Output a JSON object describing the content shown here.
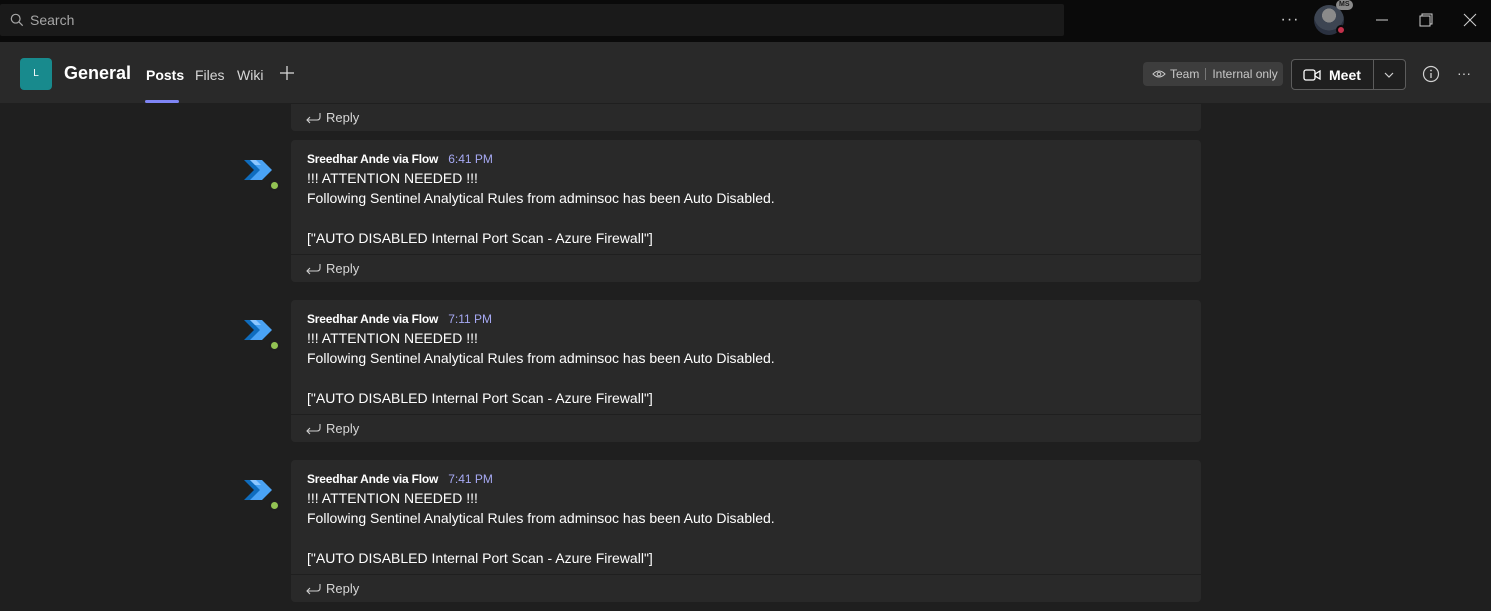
{
  "search": {
    "placeholder": "Search"
  },
  "titlebar": {
    "more_label": "···",
    "avatar_initials": "MS"
  },
  "channel": {
    "team_initial": "L",
    "name": "General",
    "tabs": [
      "Posts",
      "Files",
      "Wiki"
    ],
    "visibility_team": "Team",
    "visibility_scope": "Internal only",
    "meet_label": "Meet"
  },
  "partial_card": {
    "reply_label": "Reply"
  },
  "messages": [
    {
      "author": "Sreedhar Ande via Flow",
      "time": "6:41 PM",
      "line1": "!!! ATTENTION NEEDED !!!",
      "line2": "Following Sentinel Analytical Rules from adminsoc has been Auto Disabled.",
      "line3": "[\"AUTO DISABLED Internal Port Scan - Azure Firewall\"]",
      "reply_label": "Reply"
    },
    {
      "author": "Sreedhar Ande via Flow",
      "time": "7:11 PM",
      "line1": "!!! ATTENTION NEEDED !!!",
      "line2": "Following Sentinel Analytical Rules from adminsoc has been Auto Disabled.",
      "line3": "[\"AUTO DISABLED Internal Port Scan - Azure Firewall\"]",
      "reply_label": "Reply"
    },
    {
      "author": "Sreedhar Ande via Flow",
      "time": "7:41 PM",
      "line1": "!!! ATTENTION NEEDED !!!",
      "line2": "Following Sentinel Analytical Rules from adminsoc has been Auto Disabled.",
      "line3": "[\"AUTO DISABLED Internal Port Scan - Azure Firewall\"]",
      "reply_label": "Reply"
    }
  ],
  "colors": {
    "accent": "#7f85f5",
    "timestamp": "#a6a9f3",
    "team_tile": "#188a8d",
    "presence_online": "#92c353",
    "presence_busy": "#c4314b"
  },
  "icons": {
    "search": "search-icon",
    "more": "more-icon",
    "minimize": "minimize-icon",
    "maximize": "maximize-icon",
    "close": "close-icon",
    "add_tab": "plus-icon",
    "visibility": "eye-icon",
    "meet": "video-camera-icon",
    "meet_options": "chevron-down-icon",
    "info": "info-icon",
    "reply": "reply-arrow-icon",
    "flow": "power-automate-icon"
  }
}
